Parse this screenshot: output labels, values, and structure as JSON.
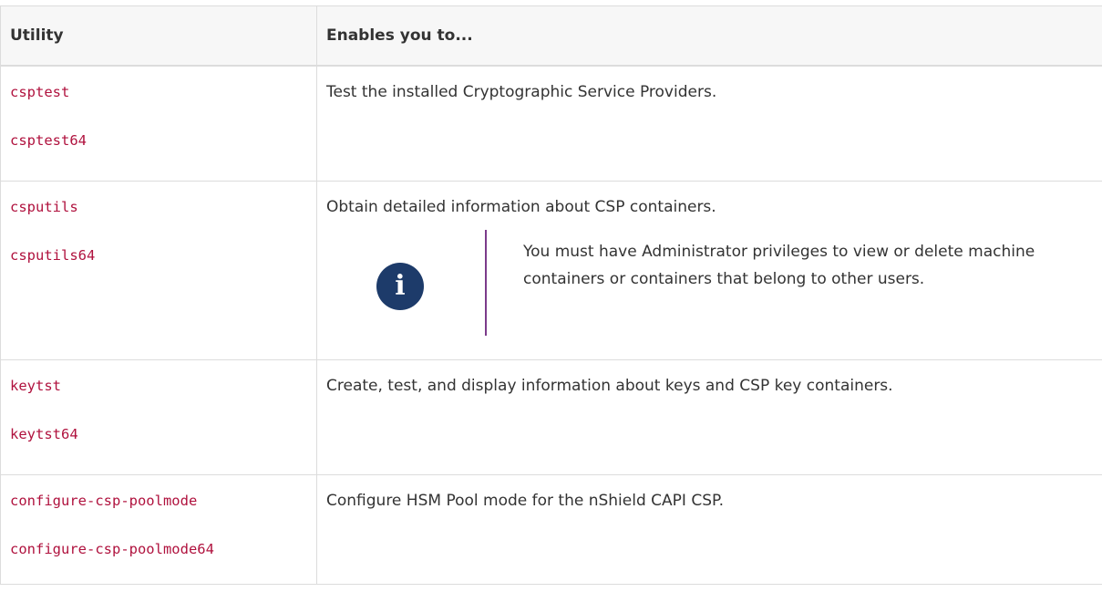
{
  "table": {
    "headers": [
      "Utility",
      "Enables you to..."
    ],
    "rows": [
      {
        "utilities": [
          "csptest",
          "csptest64"
        ],
        "description": "Test the installed Cryptographic Service Providers."
      },
      {
        "utilities": [
          "csputils",
          "csputils64"
        ],
        "description": "Obtain detailed information about CSP containers.",
        "note": {
          "icon": "info-icon",
          "text": "You must have Administrator privileges to view or delete machine containers or containers that belong to other users."
        }
      },
      {
        "utilities": [
          "keytst",
          "keytst64"
        ],
        "description": "Create, test, and display information about keys and CSP key containers."
      },
      {
        "utilities": [
          "configure-csp-poolmode",
          "configure-csp-poolmode64"
        ],
        "description": "Configure HSM Pool mode for the nShield CAPI CSP."
      }
    ]
  },
  "colors": {
    "code_text": "#b0123e",
    "note_icon_bg": "#1d3b6a",
    "note_bar": "#7b3b8a",
    "header_bg": "#f7f7f7",
    "border": "#dcdcdc"
  }
}
